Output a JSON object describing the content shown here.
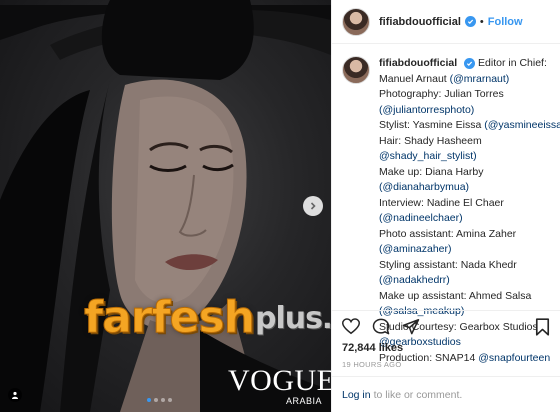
{
  "header": {
    "username": "fifiabdouofficial",
    "separator": "•",
    "follow_label": "Follow"
  },
  "caption": {
    "author": "fifiabdouofficial",
    "lines": [
      {
        "text": "Editor in Chief:",
        "mention": ""
      },
      {
        "text": "Manuel Arnaut ",
        "mention": "(@mrarnaut)"
      },
      {
        "text": "Photography: Julian Torres",
        "mention": ""
      },
      {
        "text": "",
        "mention": "(@juliantorresphoto)"
      },
      {
        "text": "Stylist: Yasmine Eissa ",
        "mention": "(@yasmineeissa)"
      },
      {
        "text": "Hair: Shady Hasheem",
        "mention": ""
      },
      {
        "text": "",
        "mention": "@shady_hair_stylist)"
      },
      {
        "text": "Make up: Diana Harby",
        "mention": ""
      },
      {
        "text": "",
        "mention": "(@dianaharbymua)"
      },
      {
        "text": "Interview: Nadine El Chaer",
        "mention": ""
      },
      {
        "text": "",
        "mention": "(@nadineelchaer)"
      },
      {
        "text": "Photo assistant: Amina Zaher",
        "mention": ""
      },
      {
        "text": "",
        "mention": "(@aminazaher)"
      },
      {
        "text": "Styling assistant: Nada Khedr",
        "mention": ""
      },
      {
        "text": "",
        "mention": "(@nadakhedrr)"
      },
      {
        "text": "Make up assistant: Ahmed Salsa",
        "mention": ""
      },
      {
        "text": "",
        "mention": "(@salsa_meakup)"
      },
      {
        "text": "Studio Courtesy: Gearbox Studios",
        "mention": ""
      },
      {
        "text": "",
        "mention": "@gearboxstudios"
      },
      {
        "text": "Production: SNAP14 ",
        "mention": "@snapfourteen"
      }
    ]
  },
  "post": {
    "likes": "72,844 likes",
    "time": "19 HOURS AGO"
  },
  "comment": {
    "login_label": "Log in",
    "rest": "to like or comment."
  },
  "photo": {
    "watermark_main": "farfesh",
    "watermark_plus": "plus",
    "watermark_com": ".com",
    "vogue": "VOGUE",
    "arabia": "ARABIA",
    "slide_index": 1,
    "slide_count": 4
  },
  "icons": {
    "next": "chevron-right-icon",
    "user_tag": "user-tag-icon",
    "heart": "heart-icon",
    "comment": "comment-icon",
    "share": "share-icon",
    "bookmark": "bookmark-icon",
    "verified": "verified-badge-icon"
  },
  "colors": {
    "accent": "#3897f0",
    "link": "#003569",
    "watermark_orange": "#f4a523",
    "muted": "#999999"
  }
}
